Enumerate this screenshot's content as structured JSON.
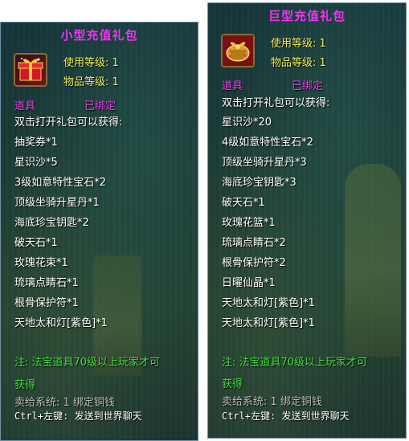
{
  "left": {
    "title": "小型充值礼包",
    "use_level": "使用等级: 1",
    "item_level": "物品等级: 1",
    "type": "道具",
    "bound": "已绑定",
    "intro": "双击打开礼包可以获得:",
    "items": [
      "抽奖券*1",
      "星识沙*5",
      "3级如意特性宝石*2",
      "顶级坐骑升星丹*1",
      "海底珍宝钥匙*2",
      "破天石*1",
      "玫瑰花束*1",
      "琉璃点睛石*1",
      "根骨保护符*1",
      "天地太和灯[紫色]*1"
    ],
    "note_line1": "注: 法宝道具70级以上玩家才可",
    "note_line2": "获得",
    "sell": "卖给系统: 1 绑定铜钱",
    "ctrl": "Ctrl+左键: 发送到世界聊天",
    "icon": "red-gift-box-icon"
  },
  "right": {
    "title": "巨型充值礼包",
    "use_level": "使用等级: 1",
    "item_level": "物品等级: 1",
    "type": "道具",
    "bound": "已绑定",
    "intro": "双击打开礼包可以获得:",
    "items": [
      "星识沙*20",
      "4级如意特性宝石*2",
      "顶级坐骑升星丹*3",
      "海底珍宝钥匙*3",
      "破天石*1",
      "玫瑰花篮*1",
      "琉璃点睛石*2",
      "根骨保护符*2",
      "日曜仙晶*1",
      "天地太和灯[紫色]*1",
      "天地太和灯[紫色]*1"
    ],
    "note_line1": "注: 法宝道具70级以上玩家才可",
    "note_line2": "获得",
    "sell": "卖给系统: 1 绑定铜钱",
    "ctrl": "Ctrl+左键: 发送到世界聊天",
    "icon": "gold-gift-basket-icon"
  },
  "colors": {
    "title": "#ee33ee",
    "level": "#f2ee5a",
    "note": "#43e043",
    "text": "#ffffff"
  }
}
